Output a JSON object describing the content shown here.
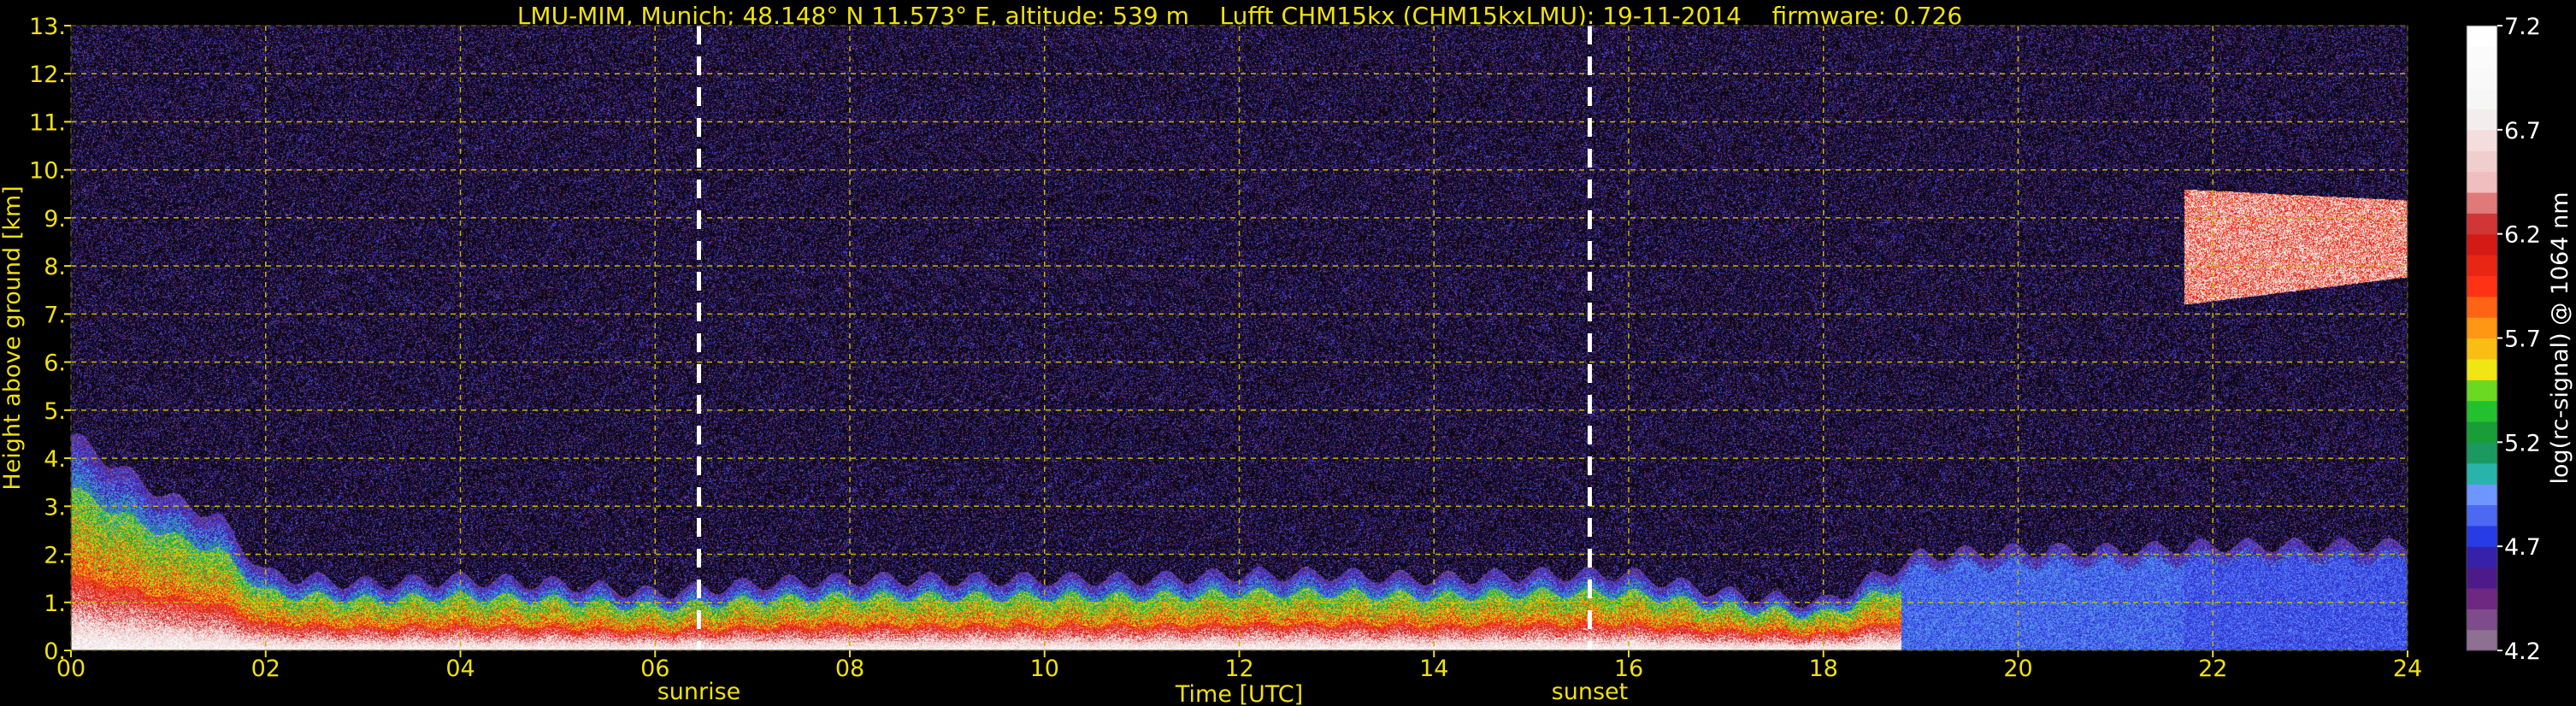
{
  "title": "LMU-MIM, Munich; 48.148° N 11.573° E, altitude: 539 m    Lufft CHM15kx (CHM15kxLMU): 19-11-2014    firmware: 0.726",
  "chart_data": {
    "type": "heatmap",
    "xlabel": "Time [UTC]",
    "ylabel": "Height above ground [km]",
    "xlim": [
      0,
      24
    ],
    "ylim": [
      0,
      13
    ],
    "x_ticks": [
      "00",
      "02",
      "04",
      "06",
      "08",
      "10",
      "12",
      "14",
      "16",
      "18",
      "20",
      "22",
      "24"
    ],
    "y_ticks": [
      "0.",
      "1.",
      "2.",
      "3.",
      "4.",
      "5.",
      "6.",
      "7.",
      "8.",
      "9.",
      "10.",
      "11.",
      "12.",
      "13."
    ],
    "grid": true,
    "annotations": [
      {
        "label": "sunrise",
        "x": 6.45
      },
      {
        "label": "sunset",
        "x": 15.6
      }
    ],
    "colorbar": {
      "label": "log(rc-signal) @ 1064 nm",
      "range": [
        4.2,
        7.2
      ],
      "ticks": [
        "4.2",
        "4.7",
        "5.2",
        "5.7",
        "6.2",
        "6.7",
        "7.2"
      ]
    },
    "features": [
      {
        "kind": "boundary_layer_top_km",
        "times": [
          0,
          0.5,
          1,
          1.5,
          2,
          3,
          4,
          5,
          6,
          7,
          8,
          9,
          10,
          11,
          12,
          13,
          14,
          15,
          16,
          17,
          18,
          19,
          20,
          21,
          22,
          23,
          24
        ],
        "values": [
          4.5,
          3.8,
          3.2,
          2.8,
          1.6,
          1.4,
          1.5,
          1.4,
          1.2,
          1.4,
          1.5,
          1.5,
          1.5,
          1.5,
          1.6,
          1.6,
          1.5,
          1.6,
          1.6,
          1.2,
          1.0,
          2.0,
          2.1,
          2.1,
          2.2,
          2.2,
          2.2
        ]
      },
      {
        "kind": "cirrus_cloud",
        "x_range": [
          21.7,
          24
        ],
        "y_range": [
          7.2,
          9.6
        ]
      }
    ]
  },
  "colors": {
    "text": "#f0e10f",
    "grid": "#c8b400",
    "background": "#000000"
  }
}
